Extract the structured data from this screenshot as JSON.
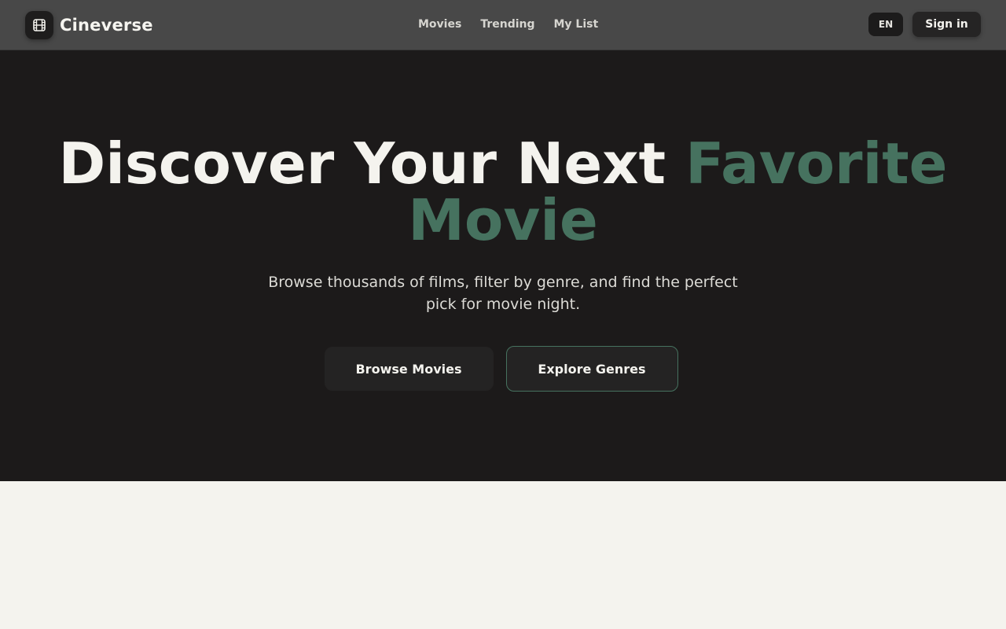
{
  "header": {
    "brand_name": "Cineverse",
    "logo_icon": "film-icon",
    "nav": [
      {
        "label": "Movies"
      },
      {
        "label": "Trending"
      },
      {
        "label": "My List"
      }
    ],
    "language": "EN",
    "signin_label": "Sign in"
  },
  "hero": {
    "title_main": "Discover Your Next ",
    "title_accent": "Favorite Movie",
    "subtitle": "Browse thousands of films, filter by genre, and find the perfect pick for movie night.",
    "primary_cta": "Browse Movies",
    "secondary_cta": "Explore Genres"
  },
  "colors": {
    "accent": "#46725f",
    "header_bg": "#484848",
    "hero_bg": "#1c1a1a",
    "page_bg": "#f4f3ee"
  }
}
